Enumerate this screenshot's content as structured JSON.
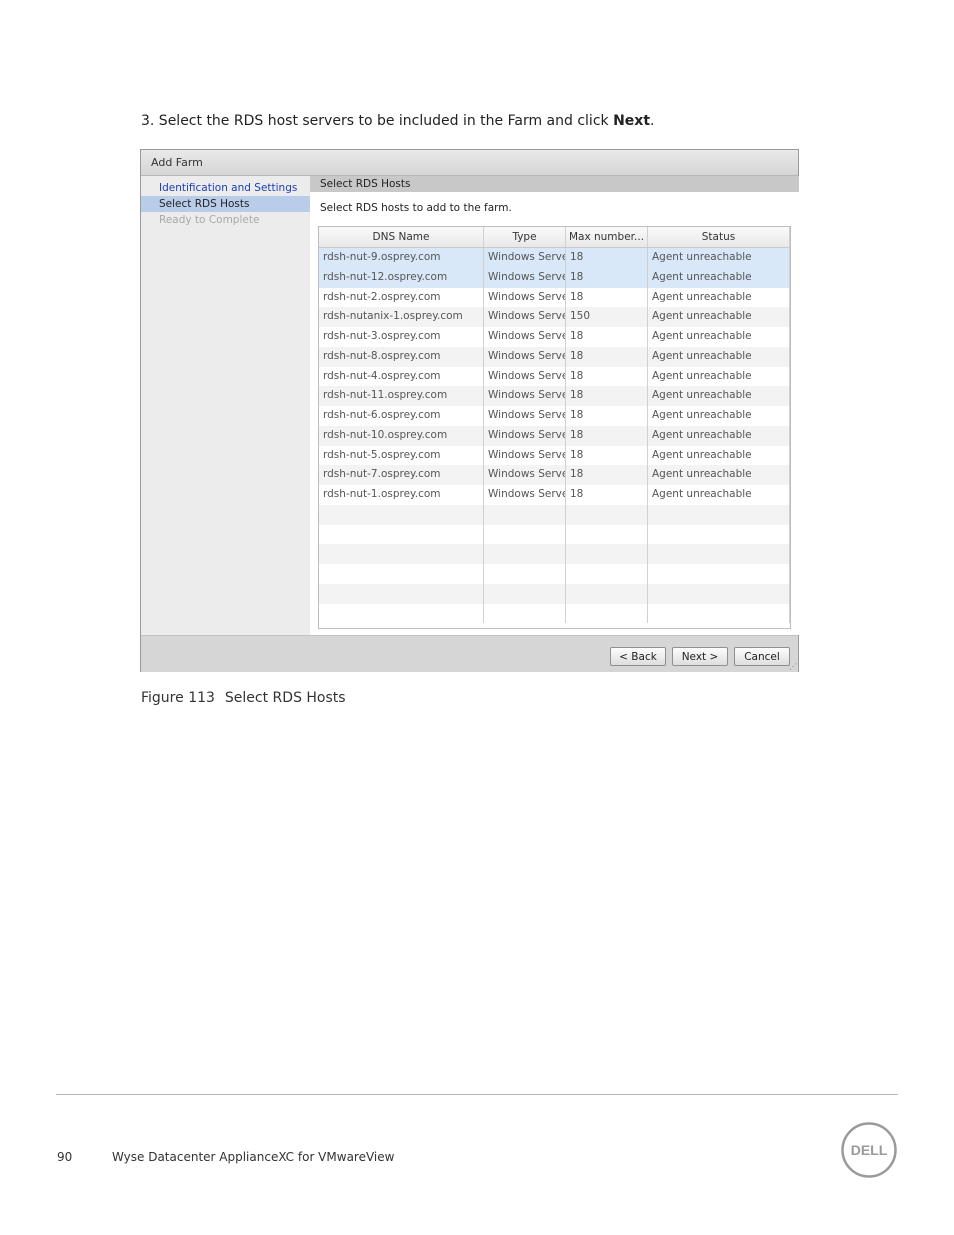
{
  "step": {
    "prefix": "3. Select the RDS host servers to be included in the Farm and click ",
    "bold": "Next",
    "suffix": "."
  },
  "dialog": {
    "title": "Add Farm",
    "nav": [
      {
        "label": "Identification and Settings",
        "state": "link"
      },
      {
        "label": "Select RDS Hosts",
        "state": "current"
      },
      {
        "label": "Ready to Complete",
        "state": "disabled"
      }
    ],
    "section_header": "Select RDS Hosts",
    "instructions": "Select RDS hosts to add to the farm.",
    "columns": [
      "DNS Name",
      "Type",
      "Max number...",
      "Status"
    ],
    "rows": [
      [
        "rdsh-nut-9.osprey.com",
        "Windows Server",
        "18",
        "Agent unreachable"
      ],
      [
        "rdsh-nut-12.osprey.com",
        "Windows Server",
        "18",
        "Agent unreachable"
      ],
      [
        "rdsh-nut-2.osprey.com",
        "Windows Server",
        "18",
        "Agent unreachable"
      ],
      [
        "rdsh-nutanix-1.osprey.com",
        "Windows Server",
        "150",
        "Agent unreachable"
      ],
      [
        "rdsh-nut-3.osprey.com",
        "Windows Server",
        "18",
        "Agent unreachable"
      ],
      [
        "rdsh-nut-8.osprey.com",
        "Windows Server",
        "18",
        "Agent unreachable"
      ],
      [
        "rdsh-nut-4.osprey.com",
        "Windows Server",
        "18",
        "Agent unreachable"
      ],
      [
        "rdsh-nut-11.osprey.com",
        "Windows Server",
        "18",
        "Agent unreachable"
      ],
      [
        "rdsh-nut-6.osprey.com",
        "Windows Server",
        "18",
        "Agent unreachable"
      ],
      [
        "rdsh-nut-10.osprey.com",
        "Windows Server",
        "18",
        "Agent unreachable"
      ],
      [
        "rdsh-nut-5.osprey.com",
        "Windows Server",
        "18",
        "Agent unreachable"
      ],
      [
        "rdsh-nut-7.osprey.com",
        "Windows Server",
        "18",
        "Agent unreachable"
      ],
      [
        "rdsh-nut-1.osprey.com",
        "Windows Server",
        "18",
        "Agent unreachable"
      ]
    ],
    "selected_rows": [
      0,
      1
    ],
    "buttons": {
      "back": "< Back",
      "next": "Next >",
      "cancel": "Cancel"
    }
  },
  "caption": {
    "figure": "Figure 113",
    "text": "Select RDS Hosts"
  },
  "footer": {
    "page": "90",
    "title": "Wyse Datacenter ApplianceXC for VMwareView"
  },
  "logo": {
    "text": "DELL",
    "icon": "dell-logo-icon"
  }
}
